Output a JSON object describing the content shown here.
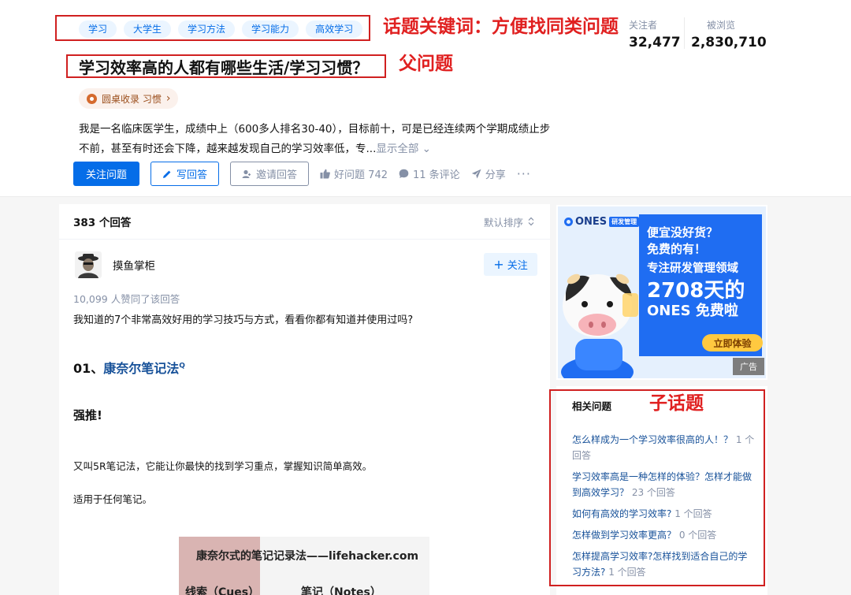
{
  "header": {
    "tags": [
      "学习",
      "大学生",
      "学习方法",
      "学习能力",
      "高效学习"
    ],
    "title": "学习效率高的人都有哪些生活/学习习惯？",
    "stats": [
      {
        "label": "关注者",
        "value": "32,477"
      },
      {
        "label": "被浏览",
        "value": "2,830,710"
      }
    ],
    "collection": {
      "label": "圆桌收录 习惯"
    },
    "description": "我是一名临床医学生，成绩中上（600多人排名30-40），目标前十，可是已经连续两个学期成绩止步不前，甚至有时还会下降，越来越发现自己的学习效率低，专...",
    "show_all": "显示全部",
    "actions": {
      "follow": "关注问题",
      "write": "写回答",
      "invite": "邀请回答",
      "good": "好问题 742",
      "comments": "11 条评论",
      "share": "分享"
    }
  },
  "annotations": {
    "tags": "话题关键词：方便找同类问题",
    "parent": "父问题",
    "child": "子话题"
  },
  "answers": {
    "count": "383 个回答",
    "sort": "默认排序",
    "author": "摸鱼掌柜",
    "follow_label": "关注",
    "voters": "10,099 人赞同了该回答",
    "intro": "我知道的7个非常高效好用的学习技巧与方式，看看你都有知道并使用过吗?",
    "section_num": "01、",
    "section_link": "康奈尔笔记法",
    "strong": "强推!",
    "p1": "又叫5R笔记法，它能让你最快的找到学习重点，掌握知识简单高效。",
    "p2": "适用于任何笔记。",
    "figure": {
      "caption": "康奈尔式的笔记记录法——lifehacker.com",
      "left": "线索（Cues）",
      "right": "笔记（Notes）"
    }
  },
  "ad": {
    "logo": "ONES",
    "logo_badge": "研发管理",
    "line1": "便宜没好货？",
    "line2": "免费的有！",
    "line3": "专注研发管理领域",
    "big": "2708天的",
    "line4": "ONES 免费啦",
    "cta": "立即体验",
    "tag": "广告"
  },
  "related": {
    "title": "相关问题",
    "items": [
      {
        "q": "怎么样成为一个学习效率很高的人！？",
        "count": "1 个回答"
      },
      {
        "q": "学习效率高是一种怎样的体验？怎样才能做到高效学习？",
        "count": "23 个回答"
      },
      {
        "q": "如何有高效的学习效率?",
        "count": "1 个回答"
      },
      {
        "q": "怎样做到学习效率更高？",
        "count": "0 个回答"
      },
      {
        "q": "怎样提高学习效率?怎样找到适合自己的学习方法?",
        "count": "1 个回答"
      }
    ]
  },
  "colors": {
    "brand": "#056de8",
    "annotation": "#e02020",
    "link": "#175199",
    "muted": "#8590a6"
  }
}
